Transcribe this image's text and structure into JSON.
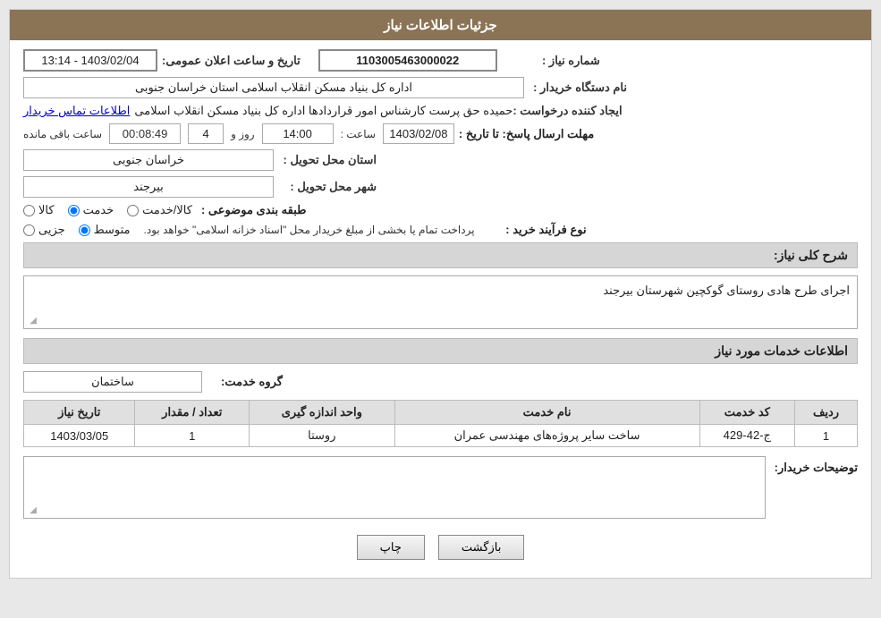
{
  "header": {
    "title": "جزئیات اطلاعات نیاز"
  },
  "fields": {
    "need_number_label": "شماره نیاز :",
    "need_number_value": "1103005463000022",
    "announce_date_label": "تاریخ و ساعت اعلان عمومی:",
    "announce_date_value": "1403/02/04 - 13:14",
    "buyer_name_label": "نام دستگاه خریدار :",
    "buyer_name_value": "اداره کل بنیاد مسکن انقلاب اسلامی استان خراسان جنوبی",
    "creator_label": "ایجاد کننده درخواست :",
    "creator_value": "حمیده حق پرست کارشناس امور قراردادها اداره کل بنیاد مسکن انقلاب اسلامی",
    "contact_link": "اطلاعات تماس خریدار",
    "deadline_label": "مهلت ارسال پاسخ: تا تاریخ :",
    "deadline_date": "1403/02/08",
    "deadline_time_label": "ساعت :",
    "deadline_time": "14:00",
    "deadline_day_label": "روز و",
    "deadline_days": "4",
    "deadline_remaining_label": "ساعت باقی مانده",
    "deadline_remaining": "00:08:49",
    "province_label": "استان محل تحویل :",
    "province_value": "خراسان جنوبی",
    "city_label": "شهر محل تحویل :",
    "city_value": "بیرجند",
    "category_label": "طبقه بندی موضوعی :",
    "category_options": [
      "کالا",
      "خدمت",
      "کالا/خدمت"
    ],
    "category_selected": "خدمت",
    "purchase_type_label": "نوع فرآیند خرید :",
    "purchase_options": [
      "جزیی",
      "متوسط"
    ],
    "purchase_selected": "متوسط",
    "purchase_note": "پرداخت تمام یا بخشی از مبلغ خریدار محل \"اسناد خزانه اسلامی\" خواهد بود.",
    "need_description_label": "شرح کلی نیاز:",
    "need_description": "اجرای طرح هادی روستای گوکچین شهرستان بیرجند",
    "services_header": "اطلاعات خدمات مورد نیاز",
    "service_group_label": "گروه خدمت:",
    "service_group_value": "ساختمان",
    "table_headers": [
      "ردیف",
      "کد خدمت",
      "نام خدمت",
      "واحد اندازه گیری",
      "تعداد / مقدار",
      "تاریخ نیاز"
    ],
    "table_rows": [
      {
        "row": "1",
        "code": "ج-42-429",
        "name": "ساخت سایر پروژه‌های مهندسی عمران",
        "unit": "روستا",
        "quantity": "1",
        "date": "1403/03/05"
      }
    ],
    "buyer_notes_label": "توضیحات خریدار:",
    "btn_print": "چاپ",
    "btn_back": "بازگشت"
  }
}
